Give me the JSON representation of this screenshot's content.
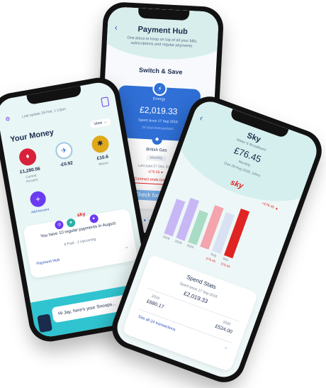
{
  "colors": {
    "primary_blue": "#2f6fd6",
    "purple": "#6a3bf2",
    "teal_bg": "#d5efee",
    "red": "#e02323",
    "bar_purple": "#c7b8f5",
    "bar_green": "#a8dcc4",
    "bar_pink": "#f4a4ad"
  },
  "phone_money": {
    "last_update": "Last update 29 Feb, 1:13pm",
    "title": "Your Money",
    "view_label": "View →",
    "accounts": [
      {
        "amount": "£1,280.56",
        "name": "Current Account",
        "icon": "bank-logo-icon"
      },
      {
        "amount": "-£0.92",
        "name": "",
        "icon": "bank-logo-icon"
      },
      {
        "amount": "£10.6",
        "name": "Monzo",
        "icon": "bank-logo-icon"
      }
    ],
    "add_account_label": "Add Account",
    "payments_text": "You have 10 regular payments in August",
    "payments_sub": "8 Paid · 2 Upcoming",
    "payment_hub_link": "Payment Hub",
    "chat_text": "Hi Jay, here's your Snoops...",
    "sky_logo": "sky"
  },
  "phone_hub": {
    "title": "Payment Hub",
    "subtitle": "One place to keep on top of all your bills, subscriptions and regular payments.",
    "section": "Switch & Save",
    "energy_label": "Energy",
    "amount": "£2,019.33",
    "spent_since": "Spent since 17 Sep 2018",
    "transactions": "24 total transactions",
    "provider": "British Gas",
    "frequency": "Monthly",
    "last_paid": "Last paid 27 Dec 2019",
    "last_amount": "-£76.50 ●",
    "contract_warning": "Contract ends tomorrow",
    "check_deals": "Check for deals"
  },
  "phone_sky": {
    "title": "Sky",
    "subtitle": "Water & Broadband",
    "amount": "£76.45",
    "frequency": "Monthly",
    "due": "Due 29 Aug 2020, 24hrs",
    "sky_logo": "sky",
    "chart_flag": "+£76.45 ▲",
    "spend_stats_title": "Spend Stats",
    "spent_since": "Spent since 17 Sep 2018",
    "total": "£2,019.33",
    "year_2019_label": "2019",
    "year_2019_amount": "£680.17",
    "year_2020_label": "2020",
    "year_2020_amount": "£534.00",
    "see_all": "See all 24 transactions",
    "bar_labels": [
      "2019",
      "2019",
      "2020",
      "Aug",
      "Sep"
    ],
    "bar_values": [
      "",
      "",
      "",
      "£76.45",
      "£76.45"
    ]
  }
}
